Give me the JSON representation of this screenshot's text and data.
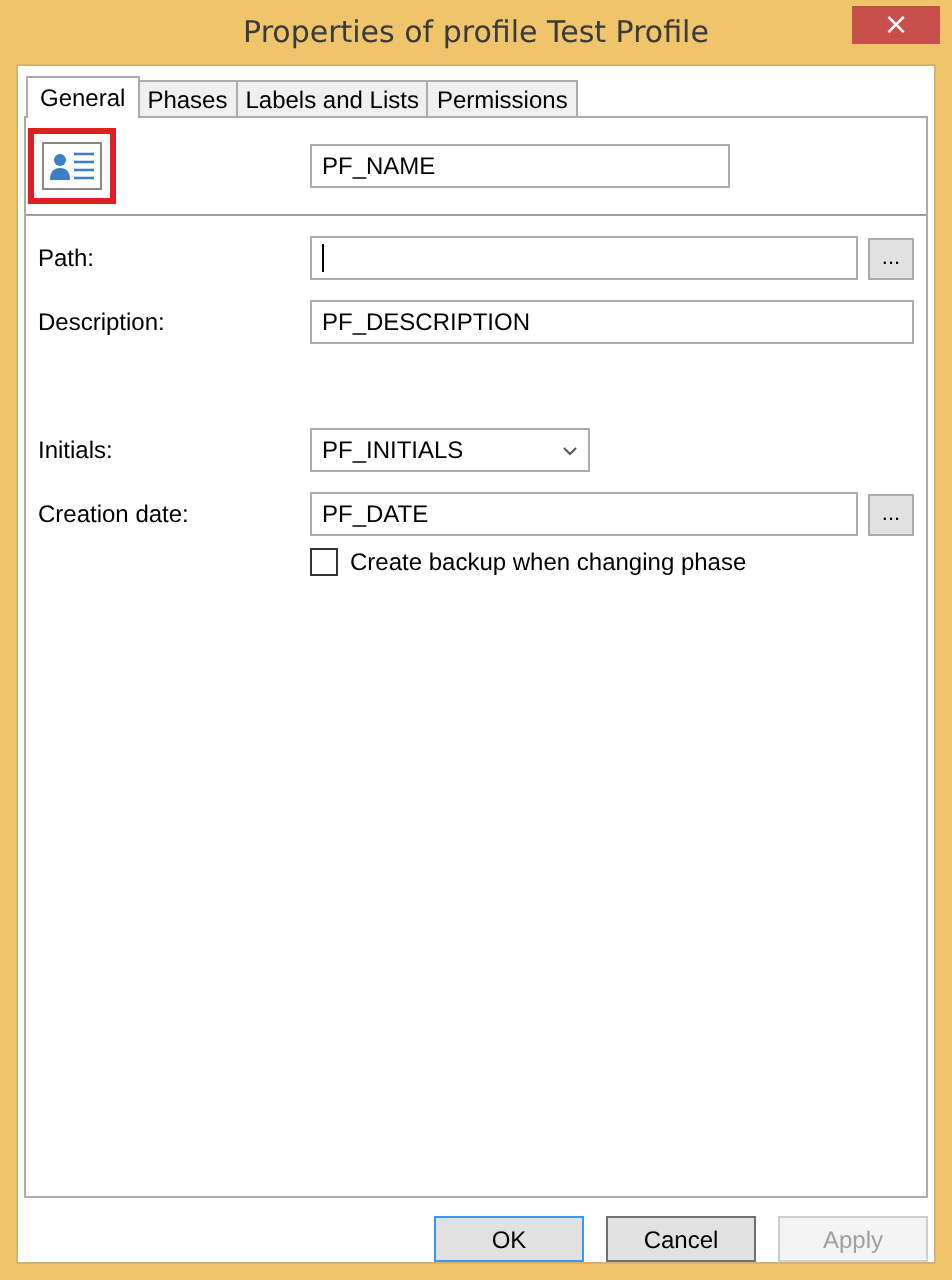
{
  "window": {
    "title": "Properties of profile Test Profile",
    "close": "×"
  },
  "tabs": [
    {
      "label": "General",
      "selected": true
    },
    {
      "label": "Phases",
      "selected": false
    },
    {
      "label": "Labels and Lists",
      "selected": false
    },
    {
      "label": "Permissions",
      "selected": false
    }
  ],
  "name_field": {
    "value": "PF_NAME"
  },
  "sections": [
    {
      "fields": [
        {
          "kind": "browse",
          "label": "Path:",
          "focused": true,
          "button": "..."
        },
        {
          "kind": "text",
          "label": "Description:",
          "value": "PF_DESCRIPTION",
          "focused": false
        }
      ]
    },
    {
      "fields": [
        {
          "kind": "combo",
          "label": "Initials:",
          "value": "PF_INITIALS",
          "focused": false
        },
        {
          "kind": "browse",
          "label": "Creation date:",
          "value": "PF_DATE",
          "focused": false,
          "button": "..."
        }
      ]
    }
  ],
  "checkbox": {
    "label": "Create backup when changing phase",
    "checked": false
  },
  "buttons": [
    {
      "label": "OK",
      "kind": "default",
      "disabled": false
    },
    {
      "label": "Cancel",
      "kind": "normal",
      "disabled": false
    },
    {
      "label": "Apply",
      "kind": "normal",
      "disabled": true
    }
  ]
}
